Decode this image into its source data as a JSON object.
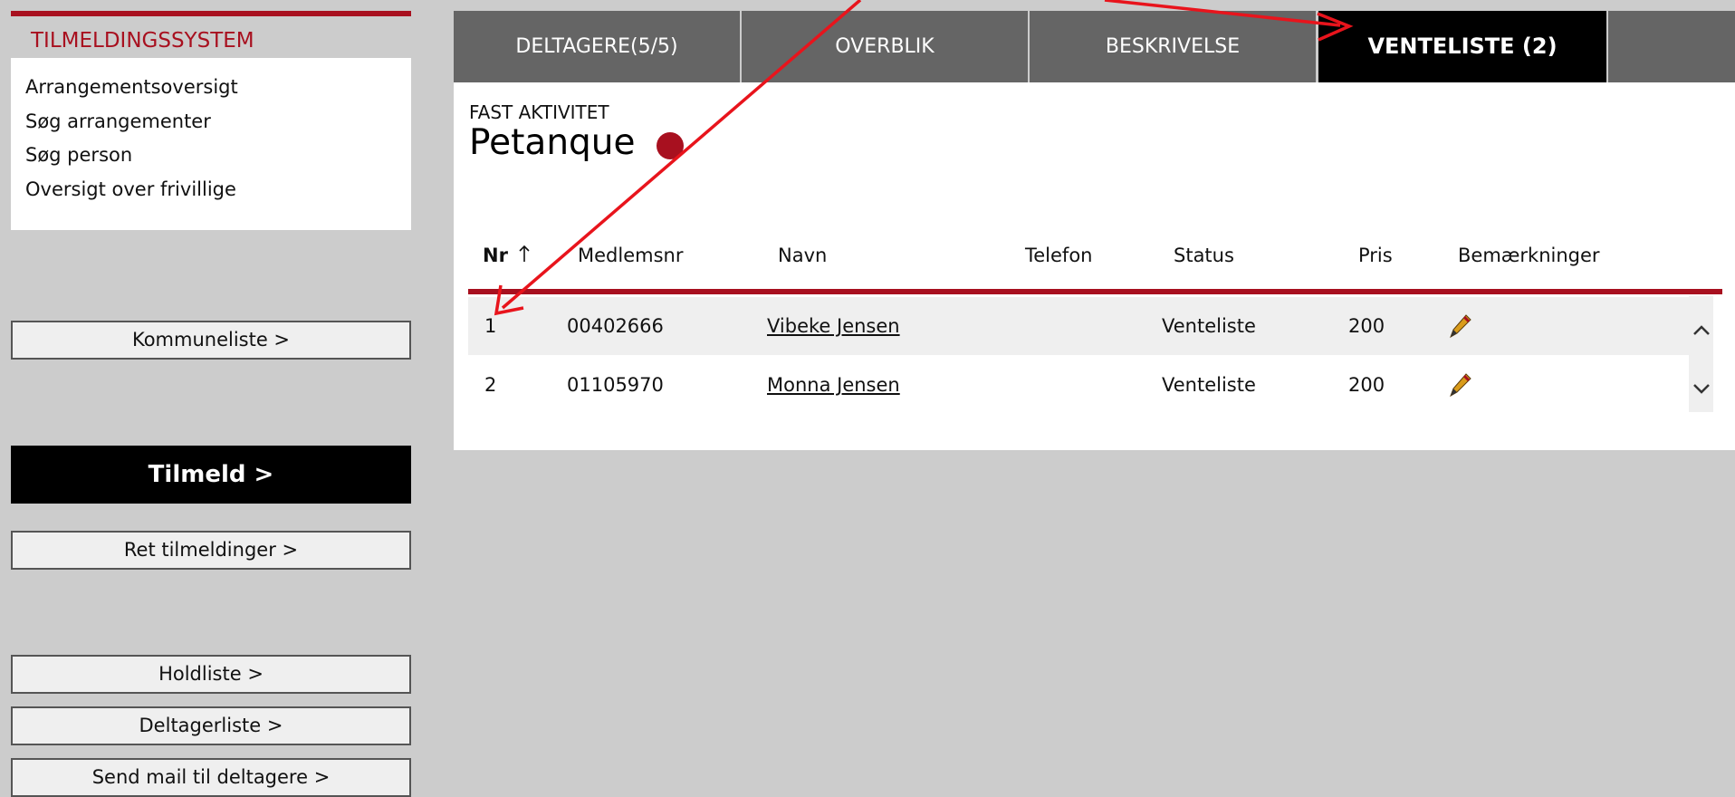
{
  "sidebar": {
    "header": "TILMELDINGSSYSTEM",
    "menu": [
      {
        "label": "Arrangementsoversigt"
      },
      {
        "label": "Søg arrangementer"
      },
      {
        "label": "Søg person"
      },
      {
        "label": "Oversigt over frivillige"
      }
    ],
    "buttons": {
      "kommuneliste": "Kommuneliste >",
      "tilmeld": "Tilmeld >",
      "ret": "Ret tilmeldinger >",
      "holdliste": "Holdliste >",
      "deltagerliste": "Deltagerliste >",
      "sendmail": "Send mail til deltagere >"
    }
  },
  "tabs": [
    {
      "label": "DELTAGERE(5/5)"
    },
    {
      "label": "OVERBLIK"
    },
    {
      "label": "BESKRIVELSE"
    },
    {
      "label": "VENTELISTE (2)",
      "active": true
    }
  ],
  "activity": {
    "type": "FAST AKTIVITET",
    "name": "Petanque",
    "status_color": "#a8101f"
  },
  "table": {
    "sort_icon": "arrow-up-icon",
    "headers": {
      "nr": "Nr",
      "medlemsnr": "Medlemsnr",
      "navn": "Navn",
      "telefon": "Telefon",
      "status": "Status",
      "pris": "Pris",
      "bemaerkninger": "Bemærkninger"
    },
    "rows": [
      {
        "nr": "1",
        "medlemsnr": "00402666",
        "navn": "Vibeke Jensen",
        "telefon": "",
        "status": "Venteliste",
        "pris": "200"
      },
      {
        "nr": "2",
        "medlemsnr": "01105970",
        "navn": "Monna Jensen",
        "telefon": "",
        "status": "Venteliste",
        "pris": "200"
      }
    ]
  },
  "colors": {
    "accent": "#a8101f",
    "annotation": "#e8141c"
  }
}
